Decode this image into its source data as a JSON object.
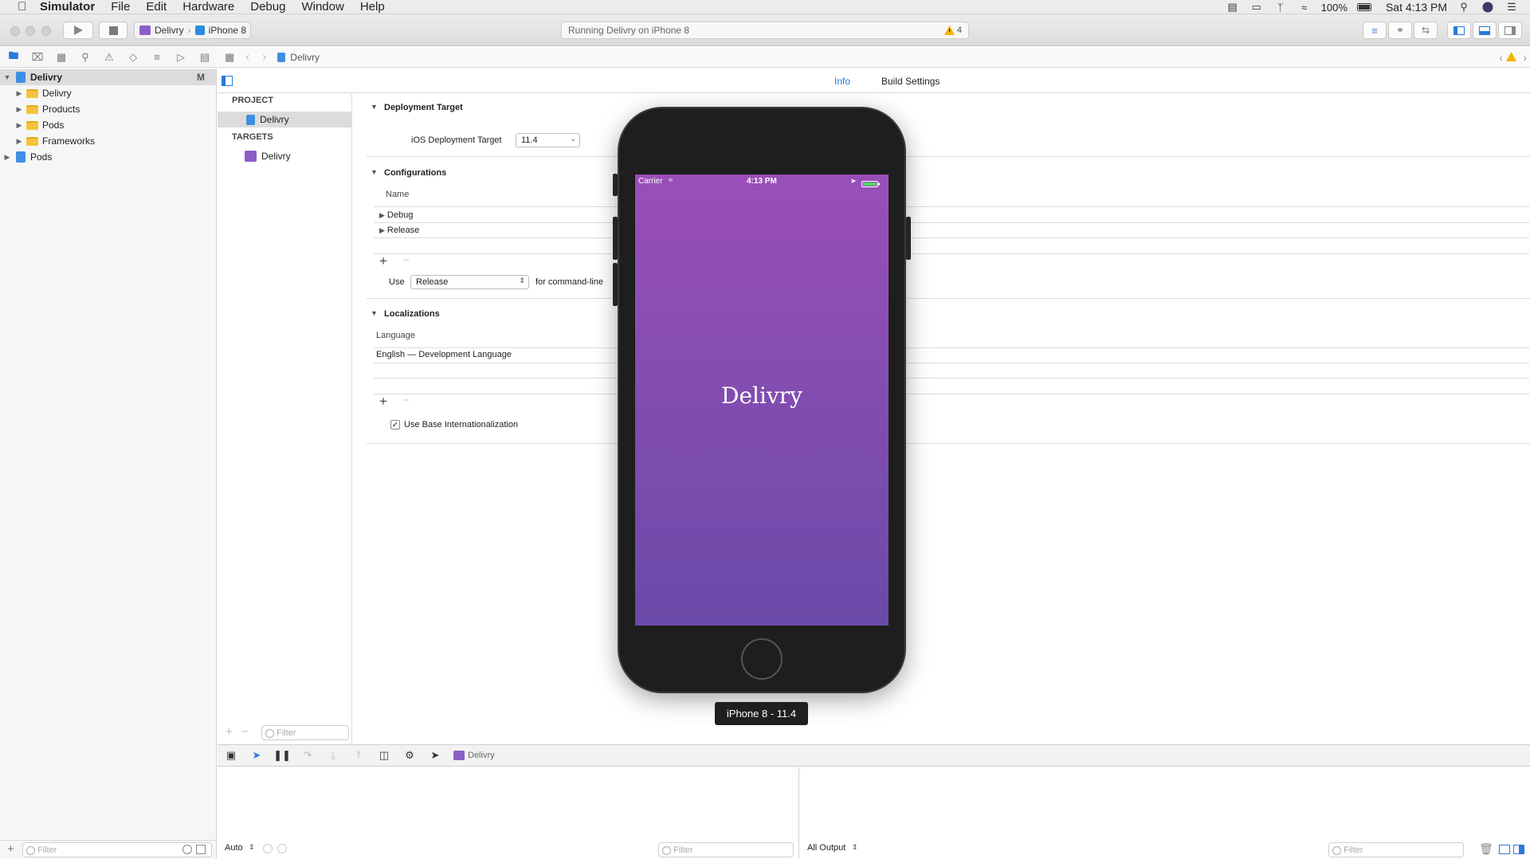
{
  "menubar": {
    "app_name": "Simulator",
    "items": [
      "File",
      "Edit",
      "Hardware",
      "Debug",
      "Window",
      "Help"
    ],
    "battery": "100%",
    "clock": "Sat 4:13 PM"
  },
  "toolbar": {
    "scheme_name": "Delivry",
    "device_name": "iPhone 8",
    "activity_text": "Running Delivry on iPhone 8",
    "warning_count": "4"
  },
  "navigator": {
    "project": {
      "label": "Delivry",
      "badge": "M"
    },
    "groups": [
      "Delivry",
      "Products",
      "Pods",
      "Frameworks"
    ],
    "pods_project": "Pods",
    "filter_placeholder": "Filter"
  },
  "jumpbar": {
    "path": "Delivry"
  },
  "editor": {
    "tabs": [
      "Info",
      "Build Settings"
    ],
    "active_tab": "Info",
    "project_header": "PROJECT",
    "project_item": "Delivry",
    "targets_header": "TARGETS",
    "target_item": "Delivry",
    "list_filter_placeholder": "Filter"
  },
  "deployment": {
    "title": "Deployment Target",
    "label": "iOS Deployment Target",
    "value": "11.4"
  },
  "configurations": {
    "title": "Configurations",
    "column": "Name",
    "items": [
      "Debug",
      "Release"
    ],
    "use_label": "Use",
    "use_value": "Release",
    "suffix": "for command-line"
  },
  "localizations": {
    "title": "Localizations",
    "column": "Language",
    "items": [
      "English — Development Language"
    ],
    "base_label": "Use Base Internationalization",
    "base_checked": true
  },
  "debug": {
    "target": "Delivry",
    "auto_label": "Auto",
    "output_label": "All Output",
    "filter_placeholder": "Filter"
  },
  "simulator": {
    "carrier": "Carrier",
    "time": "4:13 PM",
    "app_title": "Delivry",
    "device_label": "iPhone 8 - 11.4"
  },
  "colors": {
    "accent": "#1f7ae0",
    "screen_top": "#9a4fb8",
    "screen_bottom": "#6a4aa8",
    "folder": "#f4c33f"
  }
}
